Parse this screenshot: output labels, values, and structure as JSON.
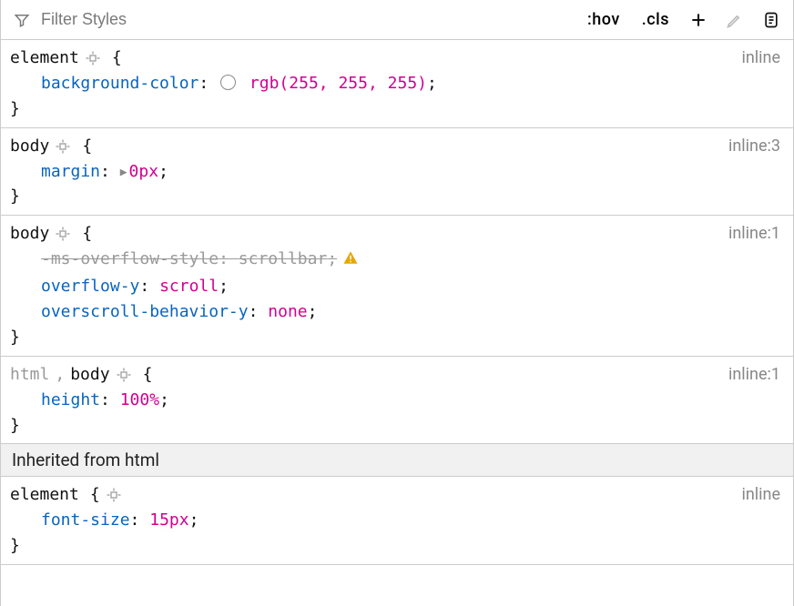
{
  "toolbar": {
    "filter_placeholder": "Filter Styles",
    "hov_label": ":hov",
    "cls_label": ".cls"
  },
  "inherited_label": "Inherited from html",
  "rules": [
    {
      "selector_parts": [
        {
          "text": "element",
          "inactive": false,
          "has_icon": true
        },
        {
          "text": "{",
          "brace": true
        }
      ],
      "source": "inline",
      "declarations": [
        {
          "prop": "background-color",
          "val": "rgb(255, 255, 255)",
          "swatch": "#ffffff",
          "overridden": false
        }
      ]
    },
    {
      "selector_parts": [
        {
          "text": "body",
          "inactive": false,
          "has_icon": true
        },
        {
          "text": "{",
          "brace": true
        }
      ],
      "source": "inline:3",
      "declarations": [
        {
          "prop": "margin",
          "val": "0px",
          "expandable": true,
          "overridden": false
        }
      ]
    },
    {
      "selector_parts": [
        {
          "text": "body",
          "inactive": false,
          "has_icon": true
        },
        {
          "text": "{",
          "brace": true
        }
      ],
      "source": "inline:1",
      "declarations": [
        {
          "prop": "-ms-overflow-style",
          "val": "scrollbar",
          "overridden": true,
          "warning": true
        },
        {
          "prop": "overflow-y",
          "val": "scroll",
          "overridden": false
        },
        {
          "prop": "overscroll-behavior-y",
          "val": "none",
          "overridden": false
        }
      ]
    },
    {
      "selector_parts": [
        {
          "text": "html",
          "inactive": true,
          "comma": true
        },
        {
          "text": "body",
          "inactive": false,
          "has_icon": true
        },
        {
          "text": "{",
          "brace": true
        }
      ],
      "source": "inline:1",
      "declarations": [
        {
          "prop": "height",
          "val": "100%",
          "overridden": false
        }
      ]
    }
  ],
  "inherited_rules": [
    {
      "selector_parts": [
        {
          "text": "element",
          "inactive": false
        },
        {
          "text": "{",
          "brace": true
        },
        {
          "has_icon": true,
          "trailing_icon": true
        }
      ],
      "source": "inline",
      "declarations": [
        {
          "prop": "font-size",
          "val": "15px",
          "overridden": false
        }
      ]
    }
  ]
}
